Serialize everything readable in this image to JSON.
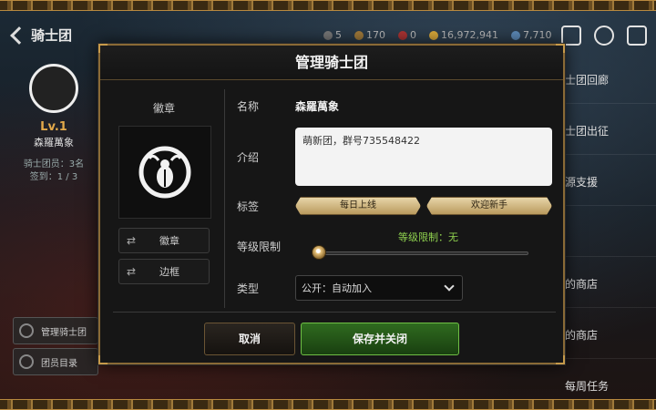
{
  "topbar": {
    "back_label": "骑士团",
    "resources": [
      {
        "icon": "resource-a-icon",
        "value": "5"
      },
      {
        "icon": "resource-b-icon",
        "value": "170"
      },
      {
        "icon": "resource-c-icon",
        "value": "0"
      },
      {
        "icon": "gold-icon",
        "value": "16,972,941"
      },
      {
        "icon": "crystal-icon",
        "value": "7,710"
      }
    ]
  },
  "left_panel": {
    "level": "Lv.1",
    "guild_name": "森羅萬象",
    "members_line": "骑士团员：3名",
    "checkin_line": "签到：1 / 3",
    "manage_label": "管理骑士团",
    "roster_label": "团员目录"
  },
  "right_menu": {
    "items": [
      "士团回廊",
      "士团出征",
      "源支援",
      "",
      "的商店",
      "的商店",
      "每周任务"
    ]
  },
  "modal": {
    "title": "管理骑士团",
    "emblem_label": "徽章",
    "emblem_button": "徽章",
    "frame_button": "边框",
    "name_label": "名称",
    "name_value": "森羅萬象",
    "intro_label": "介绍",
    "intro_value": "萌新团，群号735548422",
    "tags_label": "标签",
    "tags": [
      "每日上线",
      "欢迎新手"
    ],
    "level_label": "等级限制",
    "level_value_text": "等级限制：无",
    "level_fraction": 0.0,
    "type_label": "类型",
    "type_value": "公开：自动加入",
    "cancel_label": "取消",
    "save_label": "保存并关闭"
  },
  "colors": {
    "accent_gold": "#c79a4a",
    "save_green": "#2f6b1f",
    "level_text": "#8fd14f"
  }
}
